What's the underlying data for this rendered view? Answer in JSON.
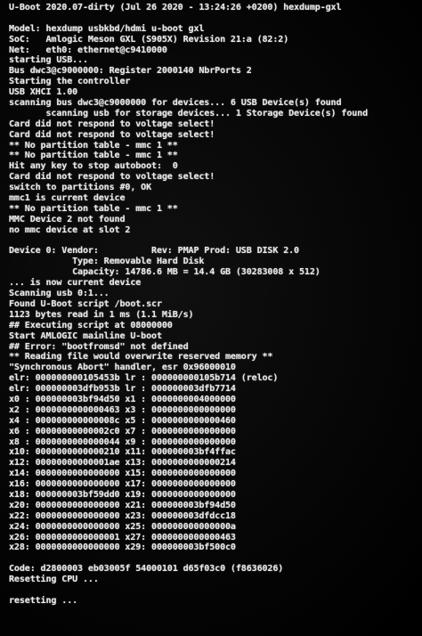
{
  "console": {
    "lines": [
      "U-Boot 2020.07-dirty (Jul 26 2020 - 13:24:26 +0200) hexdump-gxl",
      "",
      "Model: hexdump usbkbd/hdmi u-boot gxl",
      "SoC:   Amlogic Meson GXL (S905X) Revision 21:a (82:2)",
      "Net:   eth0: ethernet@c9410000",
      "starting USB...",
      "Bus dwc3@c9000000: Register 2000140 NbrPorts 2",
      "Starting the controller",
      "USB XHCI 1.00",
      "scanning bus dwc3@c9000000 for devices... 6 USB Device(s) found",
      "       scanning usb for storage devices... 1 Storage Device(s) found",
      "Card did not respond to voltage select!",
      "Card did not respond to voltage select!",
      "** No partition table - mmc 1 **",
      "** No partition table - mmc 1 **",
      "Hit any key to stop autoboot:  0",
      "Card did not respond to voltage select!",
      "switch to partitions #0, OK",
      "mmc1 is current device",
      "** No partition table - mmc 1 **",
      "MMC Device 2 not found",
      "no mmc device at slot 2",
      "",
      "Device 0: Vendor:          Rev: PMAP Prod: USB DISK 2.0",
      "            Type: Removable Hard Disk",
      "            Capacity: 14786.6 MB = 14.4 GB (30283008 x 512)",
      "... is now current device",
      "Scanning usb 0:1...",
      "Found U-Boot script /boot.scr",
      "1123 bytes read in 1 ms (1.1 MiB/s)",
      "## Executing script at 08000000",
      "Start AMLOGIC mainline U-boot",
      "## Error: \"bootfromsd\" not defined",
      "** Reading file would overwrite reserved memory **",
      "\"Synchronous Abort\" handler, esr 0x96000010",
      "elr: 000000000105453b lr : 000000000105b714 (reloc)",
      "elr: 000000003dfb953b lr : 000000003dfb7714",
      "x0 : 000000003bf94d50 x1 : 0000000004000000",
      "x2 : 0000000000000463 x3 : 0000000000000000",
      "x4 : 000000000000008c x5 : 0000000000000460",
      "x6 : 00000000000002c0 x7 : 0000000000000000",
      "x8 : 0000000000000044 x9 : 0000000000000000",
      "x10: 0000000000000210 x11: 000000003bf4ffac",
      "x12: 00000000000001ae x13: 0000000000000214",
      "x14: 0000000000000000 x15: 0000000000000000",
      "x16: 0000000000000000 x17: 0000000000000000",
      "x18: 000000003bf59dd0 x19: 0000000000000000",
      "x20: 0000000000000000 x21: 000000003bf94d50",
      "x22: 0000000000000000 x23: 000000003dfdcc18",
      "x24: 0000000000000000 x25: 000000000000000a",
      "x26: 0000000000000001 x27: 0000000000000463",
      "x28: 0000000000000000 x29: 000000003bf500c0",
      "",
      "Code: d2800003 eb03005f 54000101 d65f03c0 (f8636026)",
      "Resetting CPU ...",
      "",
      "resetting ..."
    ]
  },
  "colors": {
    "background": "#050505",
    "text": "#e8e8e8"
  }
}
